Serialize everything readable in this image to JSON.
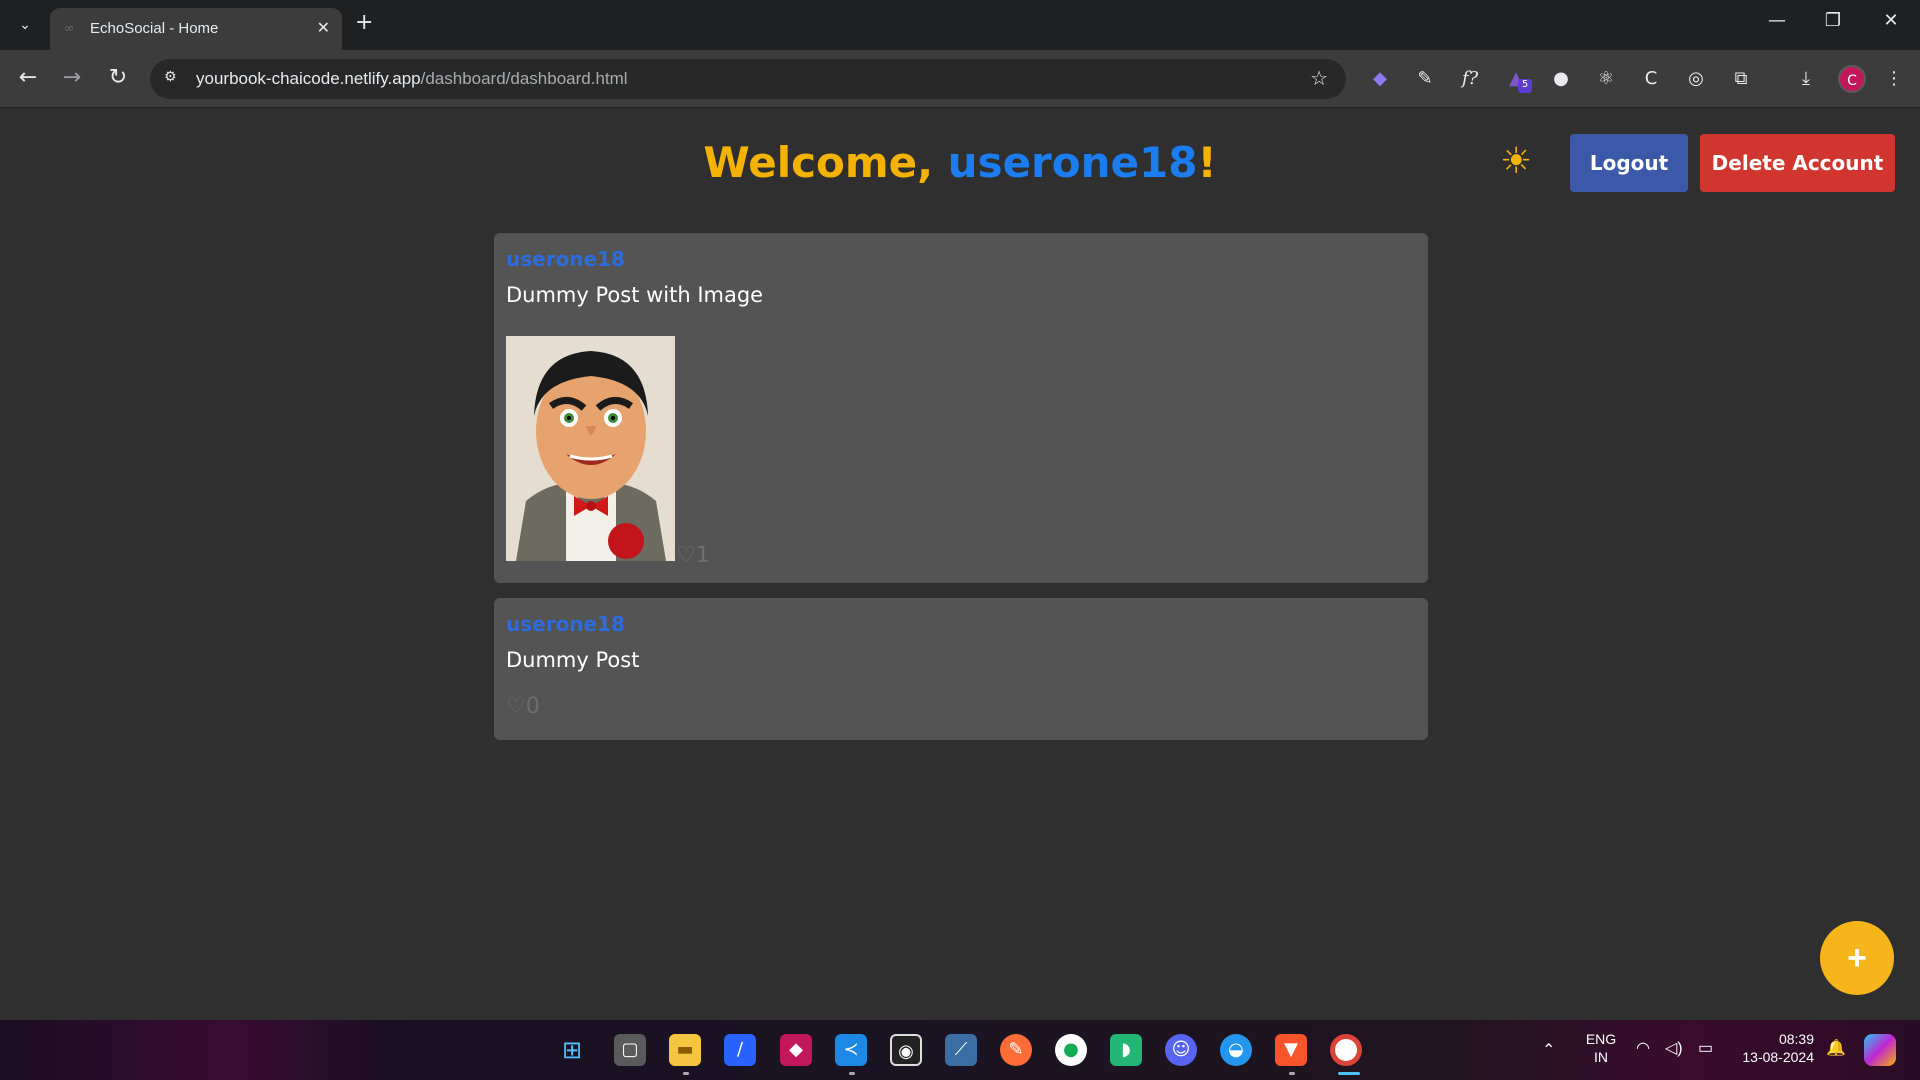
{
  "browser": {
    "tab_title": "EchoSocial - Home",
    "url_host": "yourbook-chaicode.netlify.app",
    "url_path": "/dashboard/dashboard.html",
    "profile_initial": "C",
    "extension_badge": "5"
  },
  "header": {
    "welcome_prefix": "Welcome, ",
    "username": "userone18",
    "welcome_suffix": "!",
    "logout_label": "Logout",
    "delete_label": "Delete Account"
  },
  "posts": [
    {
      "author": "userone18",
      "text": "Dummy Post with Image",
      "likes": "1",
      "has_image": true
    },
    {
      "author": "userone18",
      "text": "Dummy Post",
      "likes": "0",
      "has_image": false
    }
  ],
  "fab_label": "+",
  "taskbar": {
    "lang_top": "ENG",
    "lang_bottom": "IN",
    "time": "08:39",
    "date": "13-08-2024"
  },
  "colors": {
    "accent_yellow": "#f5b301",
    "username_blue": "#1c7df0",
    "logout_blue": "#3b59a8",
    "delete_red": "#d0362f"
  }
}
